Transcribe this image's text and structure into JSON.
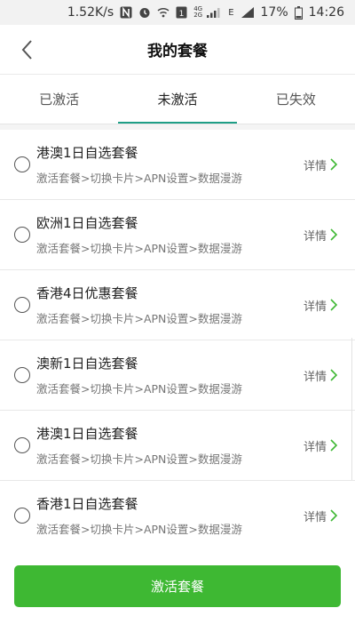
{
  "status_bar": {
    "speed": "1.52K/s",
    "network_small": "4G 2G",
    "network_letter": "E",
    "battery": "17%",
    "time": "14:26",
    "icons": [
      "nfc-icon",
      "alarm-icon",
      "wifi-icon",
      "sim-icon",
      "signal-icon",
      "battery-icon"
    ]
  },
  "header": {
    "title": "我的套餐"
  },
  "tabs": [
    {
      "label": "已激活"
    },
    {
      "label": "未激活",
      "active": true
    },
    {
      "label": "已失效"
    }
  ],
  "packages": [
    {
      "title": "港澳1日自选套餐",
      "subtitle": "激活套餐>切换卡片>APN设置>数据漫游",
      "detail": "详情"
    },
    {
      "title": "欧洲1日自选套餐",
      "subtitle": "激活套餐>切换卡片>APN设置>数据漫游",
      "detail": "详情"
    },
    {
      "title": "香港4日优惠套餐",
      "subtitle": "激活套餐>切换卡片>APN设置>数据漫游",
      "detail": "详情"
    },
    {
      "title": "澳新1日自选套餐",
      "subtitle": "激活套餐>切换卡片>APN设置>数据漫游",
      "detail": "详情"
    },
    {
      "title": "港澳1日自选套餐",
      "subtitle": "激活套餐>切换卡片>APN设置>数据漫游",
      "detail": "详情"
    },
    {
      "title": "香港1日自选套餐",
      "subtitle": "激活套餐>切换卡片>APN设置>数据漫游",
      "detail": "详情"
    }
  ],
  "footer": {
    "activate_label": "激活套餐"
  },
  "colors": {
    "accent_green": "#3eb833",
    "tab_indicator": "#1e9e86",
    "chevron_green": "#3eb833"
  }
}
